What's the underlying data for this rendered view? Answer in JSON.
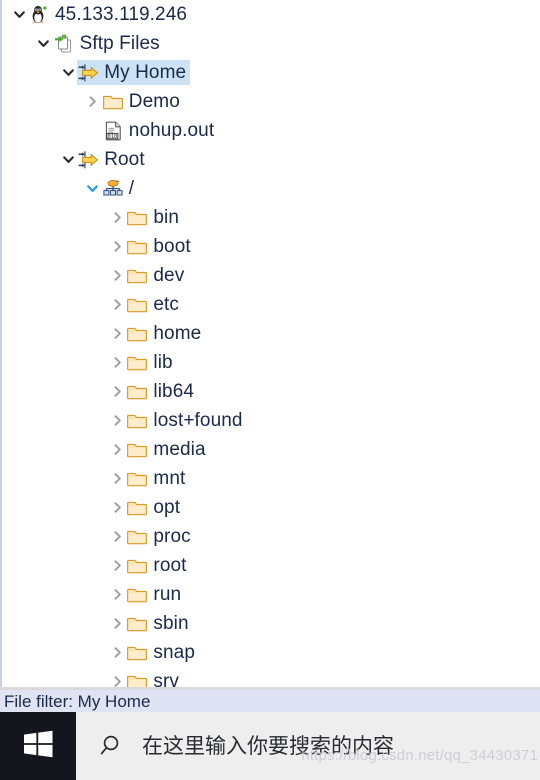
{
  "tree": {
    "rows": [
      {
        "label": "45.133.119.246",
        "icon": "linux-penguin-icon",
        "depth": 0,
        "chevron": "down",
        "selected": false
      },
      {
        "label": "Sftp Files",
        "icon": "sftp-files-icon",
        "depth": 1,
        "chevron": "down",
        "selected": false
      },
      {
        "label": "My Home",
        "icon": "sftp-home-icon",
        "depth": 2,
        "chevron": "down",
        "selected": true
      },
      {
        "label": "Demo",
        "icon": "folder-icon",
        "depth": 3,
        "chevron": "right",
        "selected": false
      },
      {
        "label": "nohup.out",
        "icon": "binary-file-icon",
        "depth": 3,
        "chevron": "none",
        "selected": false
      },
      {
        "label": "Root",
        "icon": "sftp-root-icon",
        "depth": 2,
        "chevron": "down",
        "selected": false
      },
      {
        "label": "/",
        "icon": "network-root-icon",
        "depth": 3,
        "chevron": "down-blue",
        "selected": false
      },
      {
        "label": "bin",
        "icon": "folder-icon",
        "depth": 4,
        "chevron": "right",
        "selected": false
      },
      {
        "label": "boot",
        "icon": "folder-icon",
        "depth": 4,
        "chevron": "right",
        "selected": false
      },
      {
        "label": "dev",
        "icon": "folder-icon",
        "depth": 4,
        "chevron": "right",
        "selected": false
      },
      {
        "label": "etc",
        "icon": "folder-icon",
        "depth": 4,
        "chevron": "right",
        "selected": false
      },
      {
        "label": "home",
        "icon": "folder-icon",
        "depth": 4,
        "chevron": "right",
        "selected": false
      },
      {
        "label": "lib",
        "icon": "folder-icon",
        "depth": 4,
        "chevron": "right",
        "selected": false
      },
      {
        "label": "lib64",
        "icon": "folder-icon",
        "depth": 4,
        "chevron": "right",
        "selected": false
      },
      {
        "label": "lost+found",
        "icon": "folder-icon",
        "depth": 4,
        "chevron": "right",
        "selected": false
      },
      {
        "label": "media",
        "icon": "folder-icon",
        "depth": 4,
        "chevron": "right",
        "selected": false
      },
      {
        "label": "mnt",
        "icon": "folder-icon",
        "depth": 4,
        "chevron": "right",
        "selected": false
      },
      {
        "label": "opt",
        "icon": "folder-icon",
        "depth": 4,
        "chevron": "right",
        "selected": false
      },
      {
        "label": "proc",
        "icon": "folder-icon",
        "depth": 4,
        "chevron": "right",
        "selected": false
      },
      {
        "label": "root",
        "icon": "folder-icon",
        "depth": 4,
        "chevron": "right",
        "selected": false
      },
      {
        "label": "run",
        "icon": "folder-icon",
        "depth": 4,
        "chevron": "right",
        "selected": false
      },
      {
        "label": "sbin",
        "icon": "folder-icon",
        "depth": 4,
        "chevron": "right",
        "selected": false
      },
      {
        "label": "snap",
        "icon": "folder-icon",
        "depth": 4,
        "chevron": "right",
        "selected": false
      },
      {
        "label": "srv",
        "icon": "folder-icon",
        "depth": 4,
        "chevron": "right",
        "selected": false
      }
    ]
  },
  "filter_bar": {
    "text": "File filter: My Home"
  },
  "taskbar": {
    "start_icon": "windows-logo-icon",
    "search_icon": "search-icon",
    "search_placeholder": "在这里输入你要搜索的内容"
  },
  "watermark": {
    "text": "https://blog.csdn.net/qq_34430371"
  },
  "colors": {
    "selection": "#cce3f6",
    "filter_bar_bg": "#dfe3f3",
    "taskbar_bg": "#eeeeee",
    "start_bg": "#15161d",
    "text": "#1b2a4a",
    "folder": "#f7c877",
    "accent_blue": "#2196f3"
  }
}
